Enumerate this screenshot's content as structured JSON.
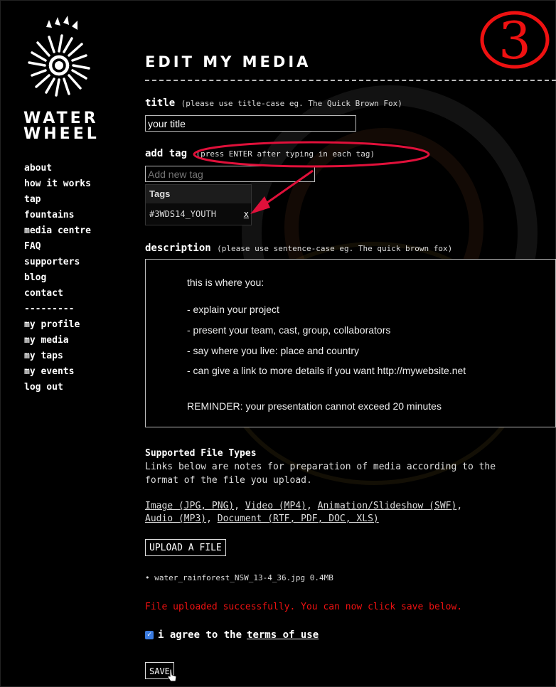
{
  "brand": {
    "line1": "WATER",
    "line2": "WHEEL"
  },
  "step_badge": "③",
  "nav": {
    "items": [
      "about",
      "how it works",
      "tap",
      "fountains",
      "media centre",
      "FAQ",
      "supporters",
      "blog",
      "contact"
    ],
    "separator": "---------",
    "user_items": [
      "my profile",
      "my media",
      "my taps",
      "my events",
      "log out"
    ]
  },
  "page": {
    "title": "EDIT MY MEDIA"
  },
  "form": {
    "title_label": "title",
    "title_hint": "(please use title-case eg. The Quick Brown Fox)",
    "title_value": "your title",
    "tag_label": "add tag",
    "tag_hint": "(press ENTER after typing in each tag)",
    "tag_placeholder": "Add new tag",
    "tags_header": "Tags",
    "tags": [
      "#3WDS14_YOUTH"
    ],
    "tag_remove": "x",
    "description_label": "description",
    "description_hint": "(please use sentence-case eg. The quick brown fox)",
    "description_lines": [
      "this is where you:",
      "- explain your project",
      "- present your team, cast, group, collaborators",
      "- say where you live: place and country",
      "- can give a link to more details if you want http://mywebsite.net",
      "REMINDER: your presentation cannot exceed 20 minutes"
    ]
  },
  "file_types": {
    "heading": "Supported File Types",
    "intro_line1": "Links below are notes for preparation of media according to the",
    "intro_line2": "format of the file you upload.",
    "links": [
      "Image (JPG, PNG)",
      "Video (MP4)",
      "Animation/Slideshow (SWF)",
      "Audio (MP3)",
      "Document (RTF, PDF, DOC, XLS)"
    ]
  },
  "upload": {
    "button_label": "UPLOAD A FILE",
    "file_name": "water_rainforest_NSW_13-4_36.jpg",
    "file_size": "0.4MB",
    "success_message": "File uploaded successfully. You can now click save below."
  },
  "agree": {
    "text": "i agree to the",
    "link": "terms of use",
    "checked": true
  },
  "save_label": "SAVE",
  "colors": {
    "annotation": "#e0103a",
    "success": "#ee1111",
    "checkbox": "#3a7be0"
  }
}
